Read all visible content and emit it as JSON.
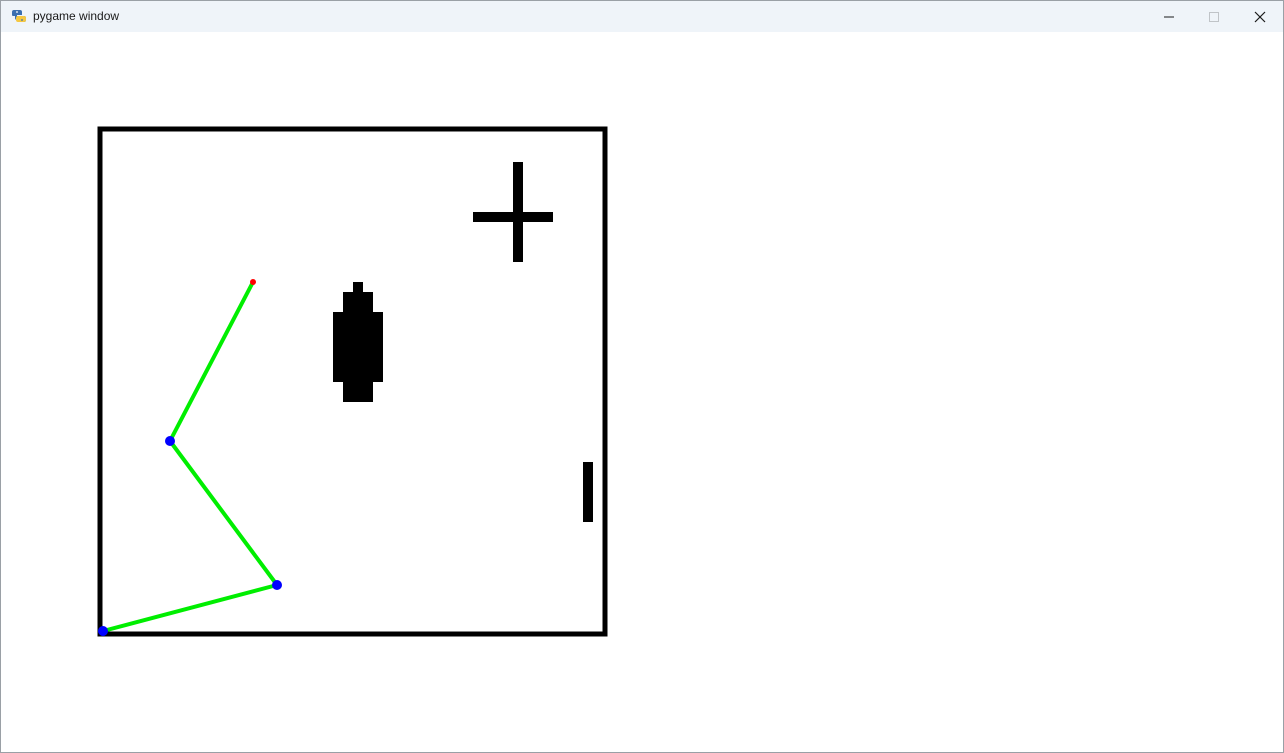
{
  "window": {
    "title": "pygame window",
    "icon": "pygame-snake-icon",
    "controls": [
      "minimize-icon",
      "maximize-icon",
      "close-icon"
    ]
  },
  "scene": {
    "background": "#ffffff",
    "arena_border_color": "#000000",
    "obstacle_color": "#000000",
    "arm_link_color": "#00ee00",
    "joint_color": "#0000ff",
    "end_effector_color": "#ff0000",
    "obstacles": [
      "cross-obstacle",
      "bottle-obstacle",
      "bar-obstacle"
    ],
    "joint_count": 3,
    "end_effector_count": 1
  }
}
